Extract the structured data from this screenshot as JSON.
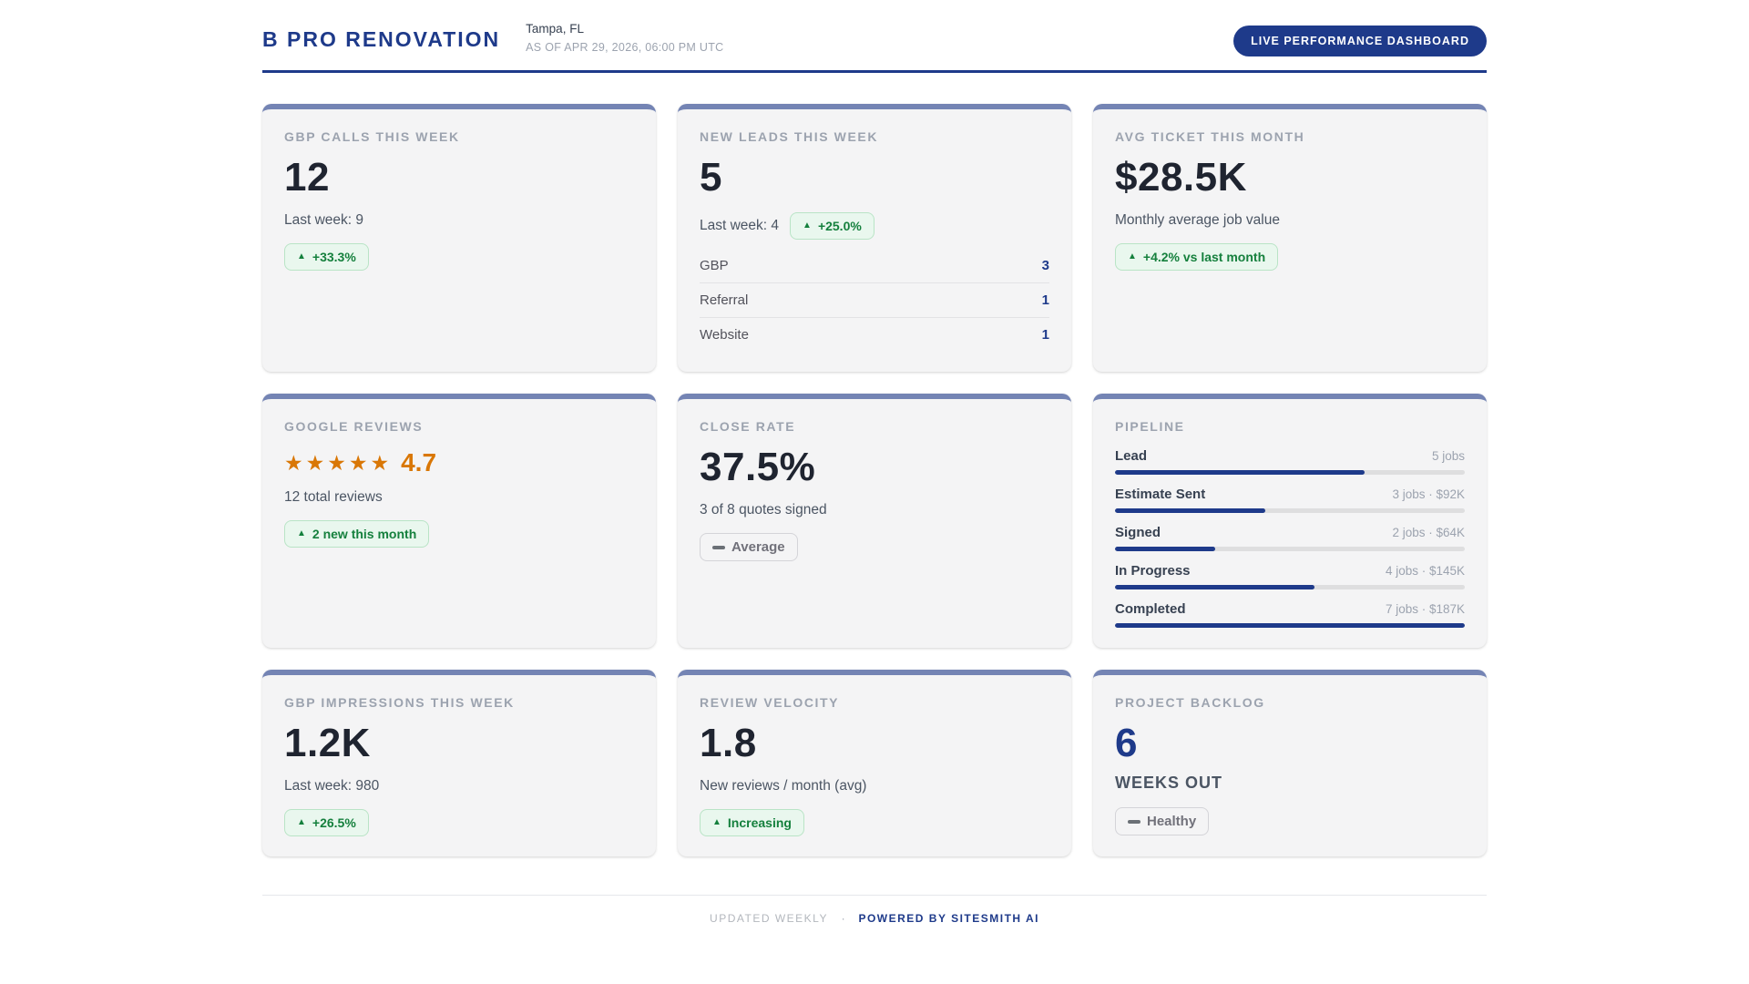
{
  "header": {
    "title": "B PRO RENOVATION",
    "location": "Tampa, FL",
    "as_of": "AS OF APR 29, 2026, 06:00 PM UTC",
    "live_badge": "LIVE PERFORMANCE DASHBOARD"
  },
  "icons": {
    "trend_up": "▲",
    "stars_five": "★★★★★"
  },
  "colors": {
    "brand_navy": "#1e3a8a",
    "card_accent": "#7484b4",
    "positive_green": "#15803d",
    "positive_green_bg": "#e9f7ee",
    "positive_green_border": "#b9e4c6",
    "star_orange": "#d97706",
    "neutral_gray": "#71717a",
    "card_bg": "#f4f4f5"
  },
  "cards": {
    "gbp_calls": {
      "label": "GBP CALLS THIS WEEK",
      "value": "12",
      "sub": "Last week: 9",
      "badge": "+33.3%"
    },
    "new_leads": {
      "label": "NEW LEADS THIS WEEK",
      "value": "5",
      "sub": "Last week: 4",
      "badge": "+25.0%",
      "sources": [
        {
          "name": "GBP",
          "count": "3"
        },
        {
          "name": "Referral",
          "count": "1"
        },
        {
          "name": "Website",
          "count": "1"
        }
      ]
    },
    "avg_ticket": {
      "label": "AVG TICKET THIS MONTH",
      "value": "$28.5K",
      "sub": "Monthly average job value",
      "badge": "+4.2% vs last month"
    },
    "google_reviews": {
      "label": "GOOGLE REVIEWS",
      "rating": "4.7",
      "sub": "12 total reviews",
      "badge": "2 new this month"
    },
    "close_rate": {
      "label": "CLOSE RATE",
      "value": "37.5%",
      "sub": "3 of 8 quotes signed",
      "badge": "Average"
    },
    "pipeline": {
      "label": "PIPELINE",
      "max_jobs": 7,
      "stages": [
        {
          "name": "Lead",
          "jobs": 5,
          "meta": "5 jobs",
          "pct": 71.4
        },
        {
          "name": "Estimate Sent",
          "jobs": 3,
          "amount": "$92K",
          "meta": "3 jobs  ·  $92K",
          "pct": 42.9
        },
        {
          "name": "Signed",
          "jobs": 2,
          "amount": "$64K",
          "meta": "2 jobs  ·  $64K",
          "pct": 28.6
        },
        {
          "name": "In Progress",
          "jobs": 4,
          "amount": "$145K",
          "meta": "4 jobs  ·  $145K",
          "pct": 57.1
        },
        {
          "name": "Completed",
          "jobs": 7,
          "amount": "$187K",
          "meta": "7 jobs  ·  $187K",
          "pct": 100
        }
      ]
    },
    "gbp_impressions": {
      "label": "GBP IMPRESSIONS THIS WEEK",
      "value": "1.2K",
      "sub": "Last week: 980",
      "badge": "+26.5%"
    },
    "review_velocity": {
      "label": "REVIEW VELOCITY",
      "value": "1.8",
      "sub": "New reviews / month (avg)",
      "badge": "Increasing"
    },
    "project_backlog": {
      "label": "PROJECT BACKLOG",
      "value": "6",
      "unit": "WEEKS OUT",
      "badge": "Healthy"
    }
  },
  "footer": {
    "updated": "UPDATED WEEKLY",
    "separator": "·",
    "powered": "POWERED BY SITESMITH AI"
  }
}
